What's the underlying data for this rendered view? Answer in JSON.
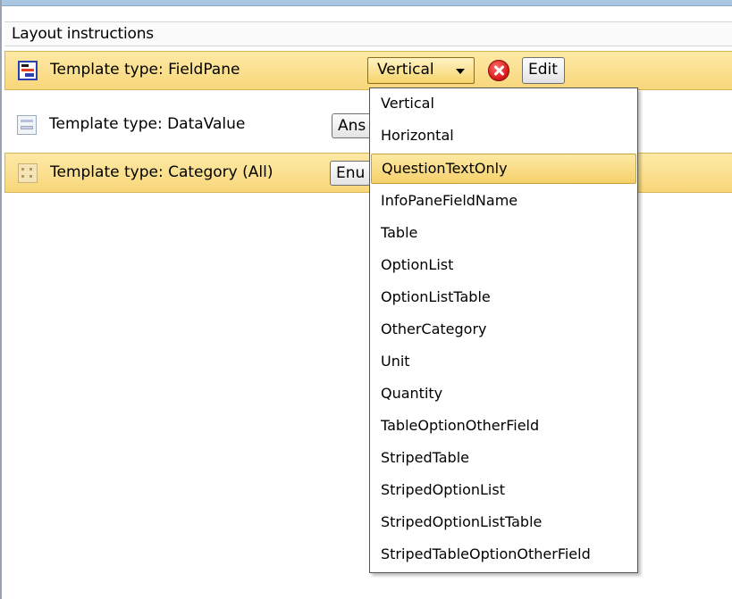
{
  "panel": {
    "title": "Layout instructions"
  },
  "rows": [
    {
      "label": "Template type: FieldPane",
      "icon": "fieldpane-template-icon",
      "highlighted": true,
      "select_value": "Vertical",
      "edit_label": "Edit"
    },
    {
      "label": "Template type: DataValue",
      "icon": "datavalue-template-icon",
      "highlighted": false,
      "button_label": "Ans"
    },
    {
      "label": "Template type: Category (All)",
      "icon": "category-template-icon",
      "highlighted": true,
      "button_label": "Enu"
    }
  ],
  "dropdown": {
    "selected": "QuestionTextOnly",
    "options": [
      "Vertical",
      "Horizontal",
      "QuestionTextOnly",
      "InfoPaneFieldName",
      "Table",
      "OptionList",
      "OptionListTable",
      "OtherCategory",
      "Unit",
      "Quantity",
      "TableOptionOtherField",
      "StripedTable",
      "StripedOptionList",
      "StripedOptionListTable",
      "StripedTableOptionOtherField"
    ]
  },
  "colors": {
    "highlight_row": "#f8d77a",
    "remove_icon": "#d81b1b",
    "selection": "#f6d06c"
  }
}
